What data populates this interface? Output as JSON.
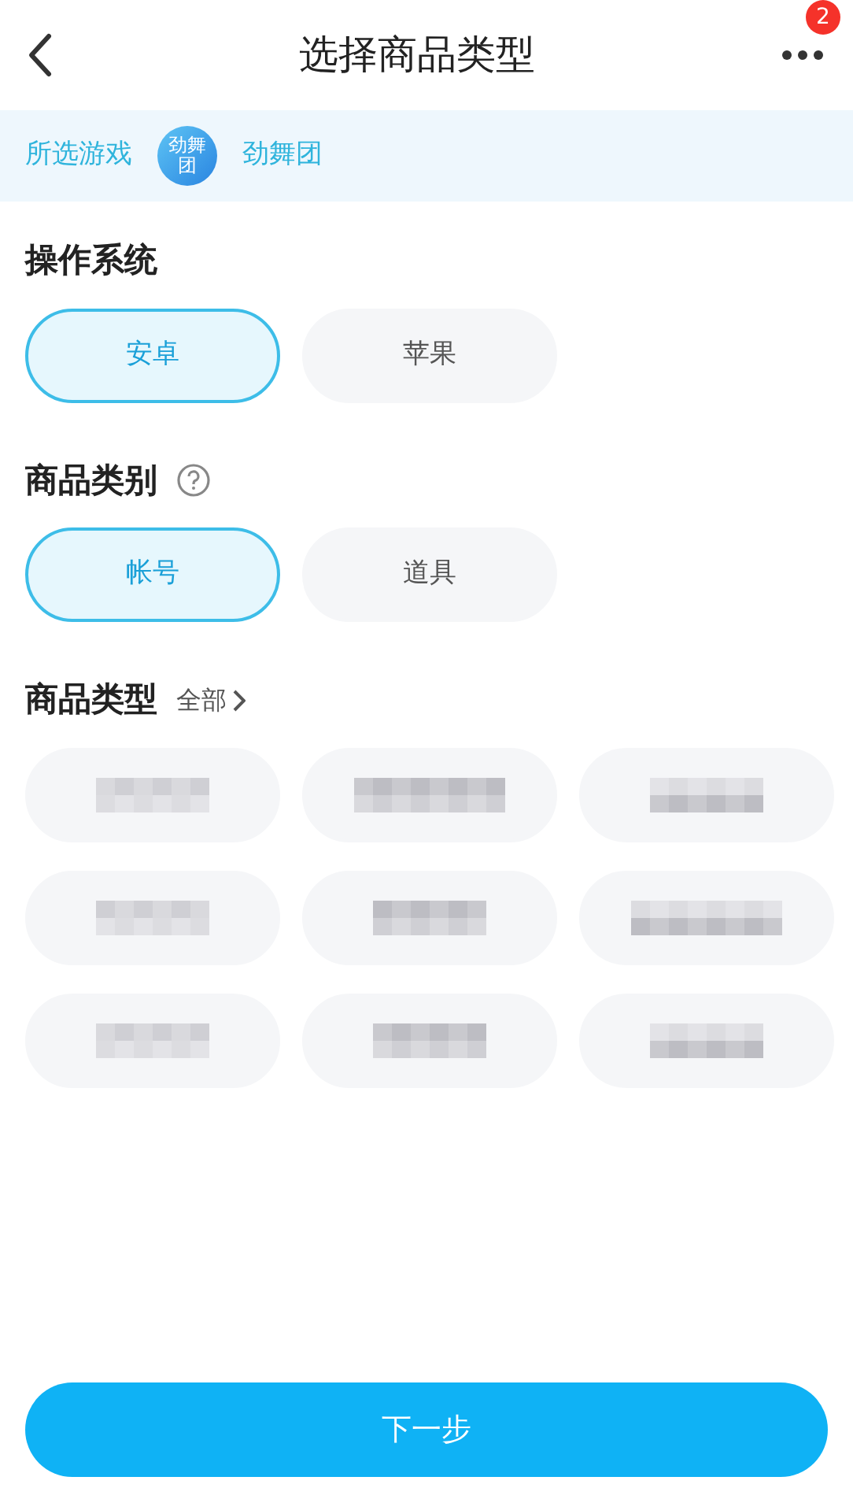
{
  "header": {
    "title": "选择商品类型",
    "badge": "2"
  },
  "game": {
    "label": "所选游戏",
    "logo_text": "劲舞团",
    "name": "劲舞团"
  },
  "sections": [
    {
      "title": "操作系统",
      "help": false,
      "options": [
        {
          "label": "安卓",
          "selected": true
        },
        {
          "label": "苹果",
          "selected": false
        }
      ]
    },
    {
      "title": "商品类别",
      "help": true,
      "options": [
        {
          "label": "帐号",
          "selected": true
        },
        {
          "label": "道具",
          "selected": false
        }
      ]
    }
  ],
  "product_types": {
    "title": "商品类型",
    "filter": "全部",
    "items": [
      {
        "selected": false
      },
      {
        "selected": false
      },
      {
        "selected": false
      },
      {
        "selected": false
      },
      {
        "selected": false
      },
      {
        "selected": false
      },
      {
        "selected": false
      },
      {
        "selected": false
      },
      {
        "selected": false
      }
    ]
  },
  "next_button": "下一步"
}
